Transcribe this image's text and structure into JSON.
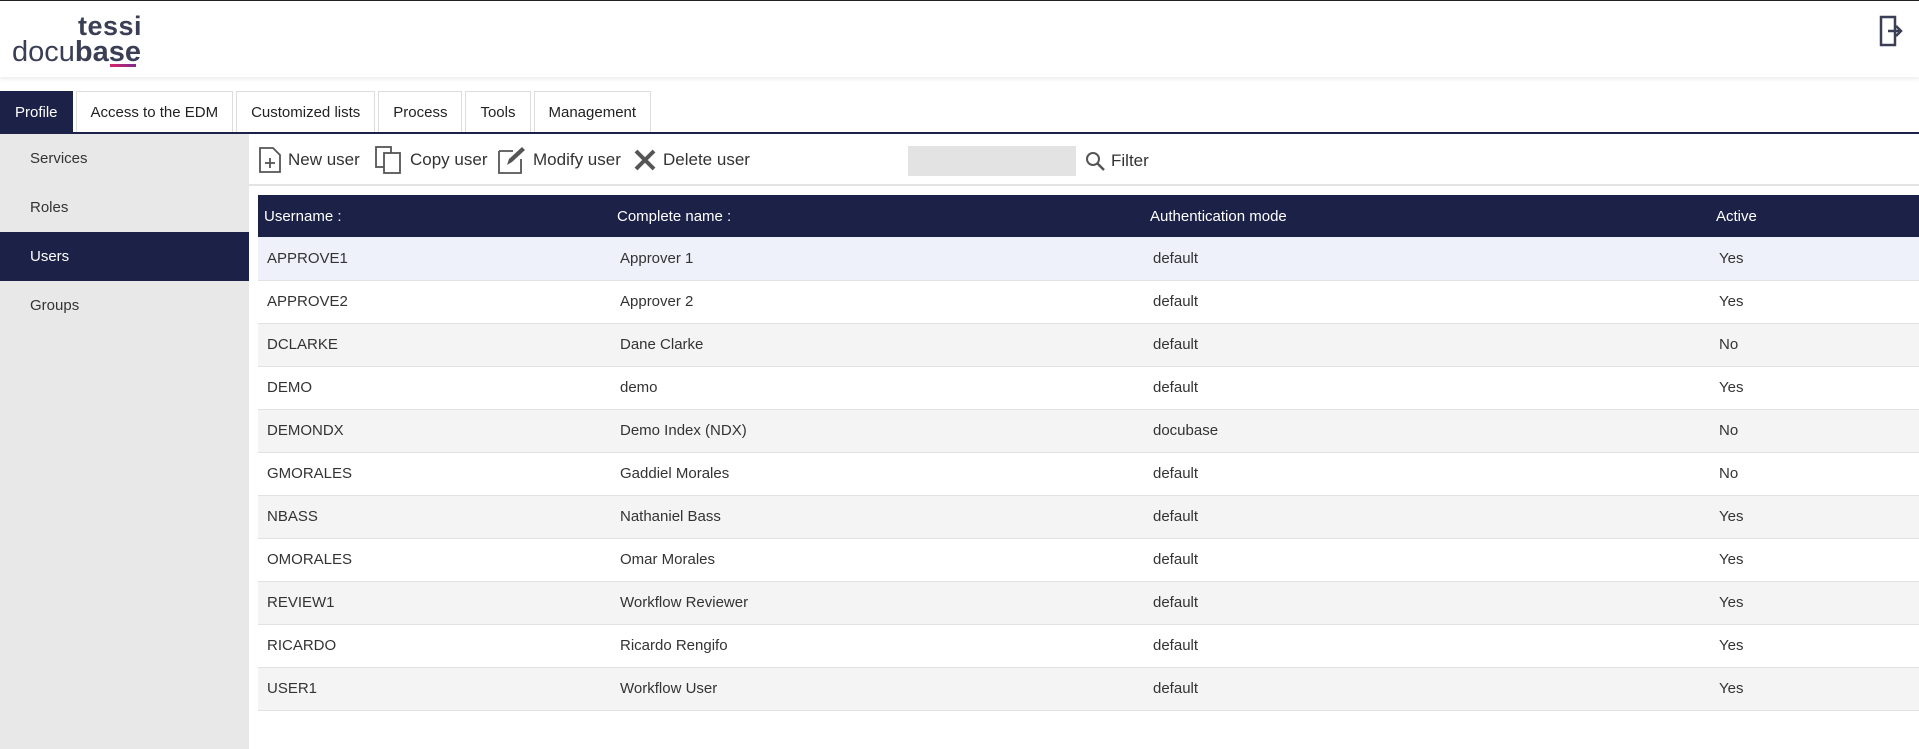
{
  "brand": {
    "top": "tessi",
    "bottom_regular": "docu",
    "bottom_bold": "base"
  },
  "tabs": [
    {
      "label": "Profile",
      "active": true
    },
    {
      "label": "Access to the EDM",
      "active": false
    },
    {
      "label": "Customized lists",
      "active": false
    },
    {
      "label": "Process",
      "active": false
    },
    {
      "label": "Tools",
      "active": false
    },
    {
      "label": "Management",
      "active": false
    }
  ],
  "sidebar": {
    "items": [
      {
        "label": "Services",
        "active": false
      },
      {
        "label": "Roles",
        "active": false
      },
      {
        "label": "Users",
        "active": true
      },
      {
        "label": "Groups",
        "active": false
      }
    ]
  },
  "toolbar": {
    "new_user": "New user",
    "copy_user": "Copy user",
    "modify_user": "Modify user",
    "delete_user": "Delete user",
    "filter_label": "Filter",
    "filter_value": ""
  },
  "table": {
    "headers": [
      "Username :",
      "Complete name :",
      "Authentication mode",
      "Active"
    ],
    "rows": [
      [
        "APPROVE1",
        "Approver 1",
        "default",
        "Yes"
      ],
      [
        "APPROVE2",
        "Approver 2",
        "default",
        "Yes"
      ],
      [
        "DCLARKE",
        "Dane Clarke",
        "default",
        "No"
      ],
      [
        "DEMO",
        "demo",
        "default",
        "Yes"
      ],
      [
        "DEMONDX",
        "Demo Index (NDX)",
        "docubase",
        "No"
      ],
      [
        "GMORALES",
        "Gaddiel Morales",
        "default",
        "No"
      ],
      [
        "NBASS",
        "Nathaniel Bass",
        "default",
        "Yes"
      ],
      [
        "OMORALES",
        "Omar Morales",
        "default",
        "Yes"
      ],
      [
        "REVIEW1",
        "Workflow Reviewer",
        "default",
        "Yes"
      ],
      [
        "RICARDO",
        "Ricardo Rengifo",
        "default",
        "Yes"
      ],
      [
        "USER1",
        "Workflow User",
        "default",
        "Yes"
      ]
    ]
  },
  "colors": {
    "navy": "#1b2147",
    "accent_pink": "#d6256b"
  },
  "icons": [
    "logout-icon",
    "new-user-icon",
    "copy-user-icon",
    "modify-user-icon",
    "delete-user-icon",
    "search-icon"
  ]
}
